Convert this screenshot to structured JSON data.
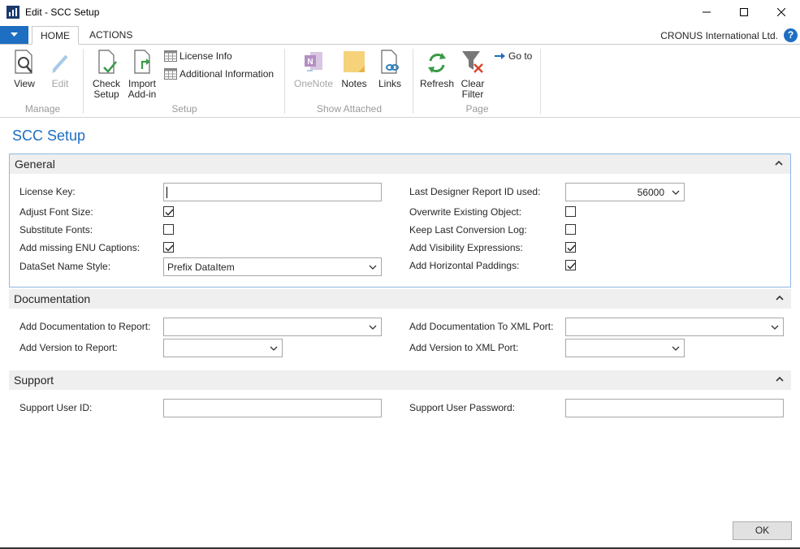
{
  "window": {
    "title": "Edit - SCC Setup"
  },
  "ribbon": {
    "tabs": [
      "HOME",
      "ACTIONS"
    ],
    "company": "CRONUS International Ltd.",
    "help": "?",
    "groups": {
      "manage": {
        "label": "Manage",
        "view": "View",
        "edit": "Edit"
      },
      "setup": {
        "label": "Setup",
        "check_setup_line1": "Check",
        "check_setup_line2": "Setup",
        "import_addin_line1": "Import",
        "import_addin_line2": "Add-in",
        "license_info": "License Info",
        "additional_information": "Additional Information"
      },
      "show_attached": {
        "label": "Show Attached",
        "onenote": "OneNote",
        "notes": "Notes",
        "links": "Links"
      },
      "page": {
        "label": "Page",
        "refresh": "Refresh",
        "clear_filter_line1": "Clear",
        "clear_filter_line2": "Filter",
        "go_to": "Go to"
      }
    }
  },
  "page_title": "SCC Setup",
  "general": {
    "title": "General",
    "license_key_label": "License Key:",
    "license_key_value": "",
    "adjust_font_size_label": "Adjust Font Size:",
    "adjust_font_size_checked": true,
    "substitute_fonts_label": "Substitute Fonts:",
    "substitute_fonts_checked": false,
    "add_missing_enu_label": "Add missing ENU Captions:",
    "add_missing_enu_checked": true,
    "dataset_name_style_label": "DataSet Name Style:",
    "dataset_name_style_value": "Prefix DataItem",
    "last_report_id_label": "Last Designer Report ID used:",
    "last_report_id_value": "56000",
    "overwrite_existing_label": "Overwrite Existing Object:",
    "overwrite_existing_checked": false,
    "keep_last_log_label": "Keep Last Conversion Log:",
    "keep_last_log_checked": false,
    "add_visibility_label": "Add Visibility Expressions:",
    "add_visibility_checked": true,
    "add_horizontal_label": "Add Horizontal Paddings:",
    "add_horizontal_checked": true
  },
  "documentation": {
    "title": "Documentation",
    "doc_to_report_label": "Add Documentation to Report:",
    "doc_to_report_value": "",
    "version_to_report_label": "Add Version to Report:",
    "version_to_report_value": "",
    "doc_to_xmlport_label": "Add Documentation To XML Port:",
    "doc_to_xmlport_value": "",
    "version_to_xmlport_label": "Add Version to XML Port:",
    "version_to_xmlport_value": ""
  },
  "support": {
    "title": "Support",
    "user_id_label": "Support User ID:",
    "user_id_value": "",
    "user_password_label": "Support User Password:",
    "user_password_value": ""
  },
  "footer": {
    "ok": "OK"
  },
  "colors": {
    "accent": "#1e6ec1",
    "fasttab_border": "#8eb6e3",
    "fasttab_header": "#efefef",
    "group_label": "#9a9a9a"
  }
}
